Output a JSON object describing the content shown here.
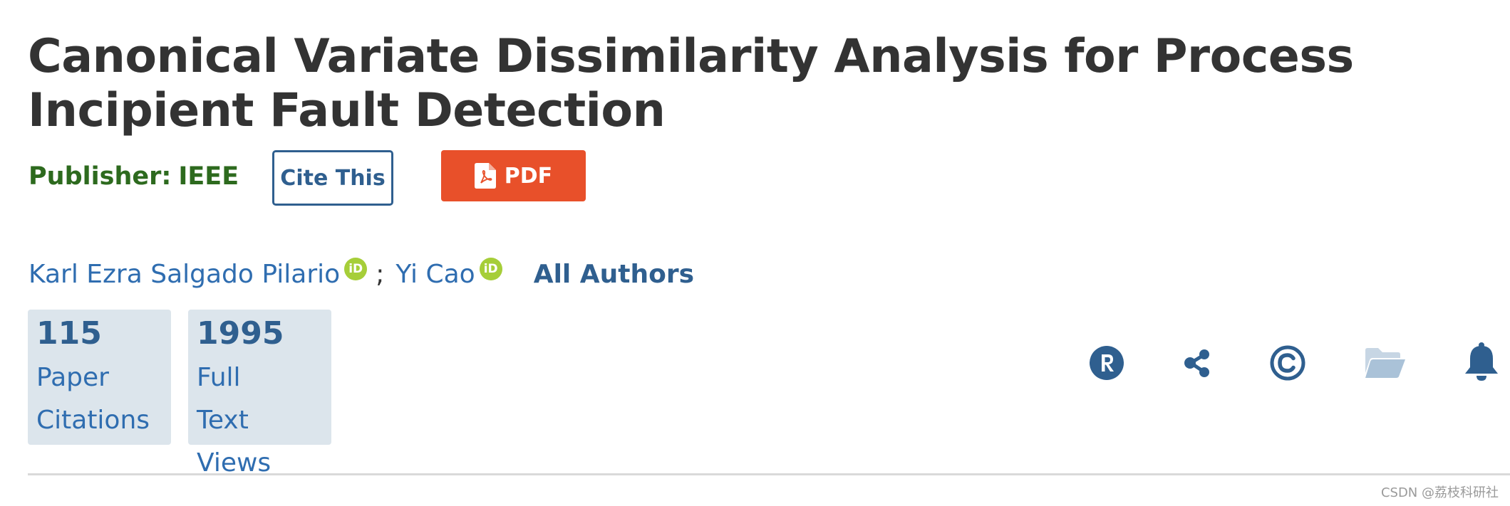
{
  "article": {
    "title": "Canonical Variate Dissimilarity Analysis for Process Incipient Fault Detection",
    "publisher_label": "Publisher:",
    "publisher_name": "IEEE"
  },
  "actions": {
    "cite_label": "Cite This",
    "pdf_label": "PDF",
    "icons": [
      "rights-icon",
      "share-icon",
      "copyright-icon",
      "folder-icon",
      "alert-bell-icon"
    ],
    "icon_color": "#2f5f8f"
  },
  "authors": {
    "list": [
      {
        "name": "Karl Ezra Salgado Pilario"
      },
      {
        "name": "Yi Cao"
      }
    ],
    "separator": ";",
    "all_authors_label": "All Authors",
    "orcid_badge": "iD"
  },
  "metrics": [
    {
      "value": "115",
      "words": [
        "Paper",
        "Citations"
      ]
    },
    {
      "value": "1995",
      "words": [
        "Full",
        "Text",
        "Views"
      ]
    }
  ],
  "watermark": "CSDN @荔枝科研社",
  "colors": {
    "title": "#333333",
    "publisher": "#2d6a1e",
    "link": "#2f6db0",
    "pdf_button": "#e8502a",
    "metric_bg": "#dce5ec",
    "orcid": "#a6ce39"
  }
}
